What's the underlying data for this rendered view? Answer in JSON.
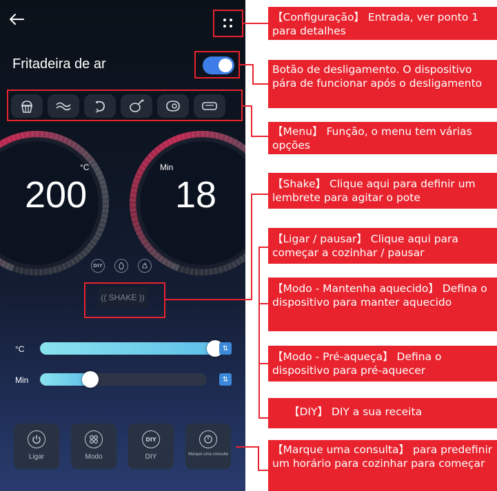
{
  "screen": {
    "title": "Fritadeira de ar",
    "power_on": true,
    "menu_icons": [
      "cupcake-icon",
      "bacon-icon",
      "shrimp-icon",
      "drumstick-icon",
      "steak-icon",
      "toast-icon"
    ],
    "temperature": {
      "unit": "°C",
      "value": "200"
    },
    "time": {
      "unit": "Min",
      "value": "18"
    },
    "mode_icons": [
      {
        "name": "diy-mode-icon",
        "text": "DIY"
      },
      {
        "name": "preheat-mode-icon",
        "text": ""
      },
      {
        "name": "keep-warm-mode-icon",
        "text": ""
      }
    ],
    "shake_label": "(( SHAKE ))",
    "sliders": [
      {
        "label": "°C",
        "level": 1.0
      },
      {
        "label": "Min",
        "level": 0.3
      }
    ],
    "actions": [
      {
        "name": "ligar",
        "label": "Ligar",
        "icon": "power-icon",
        "icon_text": ""
      },
      {
        "name": "modo",
        "label": "Modo",
        "icon": "mode-grid-icon",
        "icon_text": ""
      },
      {
        "name": "diy",
        "label": "DIY",
        "icon": "diy-icon",
        "icon_text": "DIY"
      },
      {
        "name": "consulta",
        "label": "Marque uma consulta",
        "icon": "timer-icon",
        "icon_text": ""
      }
    ],
    "colors": {
      "accent_blue": "#3d7de8",
      "dial_red": "#c72a55",
      "slider_cyan": "#7fd6ee"
    }
  },
  "callouts": [
    {
      "text": "【Configuração】 Entrada, ver ponto 1 para detalhes"
    },
    {
      "text": "Botão de desligamento. O dispositivo pára de funcionar após o desligamento"
    },
    {
      "text": "【Menu】 Função, o menu tem várias opções"
    },
    {
      "text": "【Shake】 Clique aqui para definir um lembrete para agitar o pote"
    },
    {
      "text": "【Ligar / pausar】 Clique aqui para começar a cozinhar / pausar"
    },
    {
      "text": "【Modo - Mantenha aquecido】 Defina o dispositivo para manter aquecido"
    },
    {
      "text": "【Modo - Pré-aqueça】 Defina o dispositivo para pré-aquecer"
    },
    {
      "text": "【DIY】 DIY a sua receita"
    },
    {
      "text": "【Marque uma consulta】 para predefinir um horário para cozinhar para começar"
    }
  ]
}
